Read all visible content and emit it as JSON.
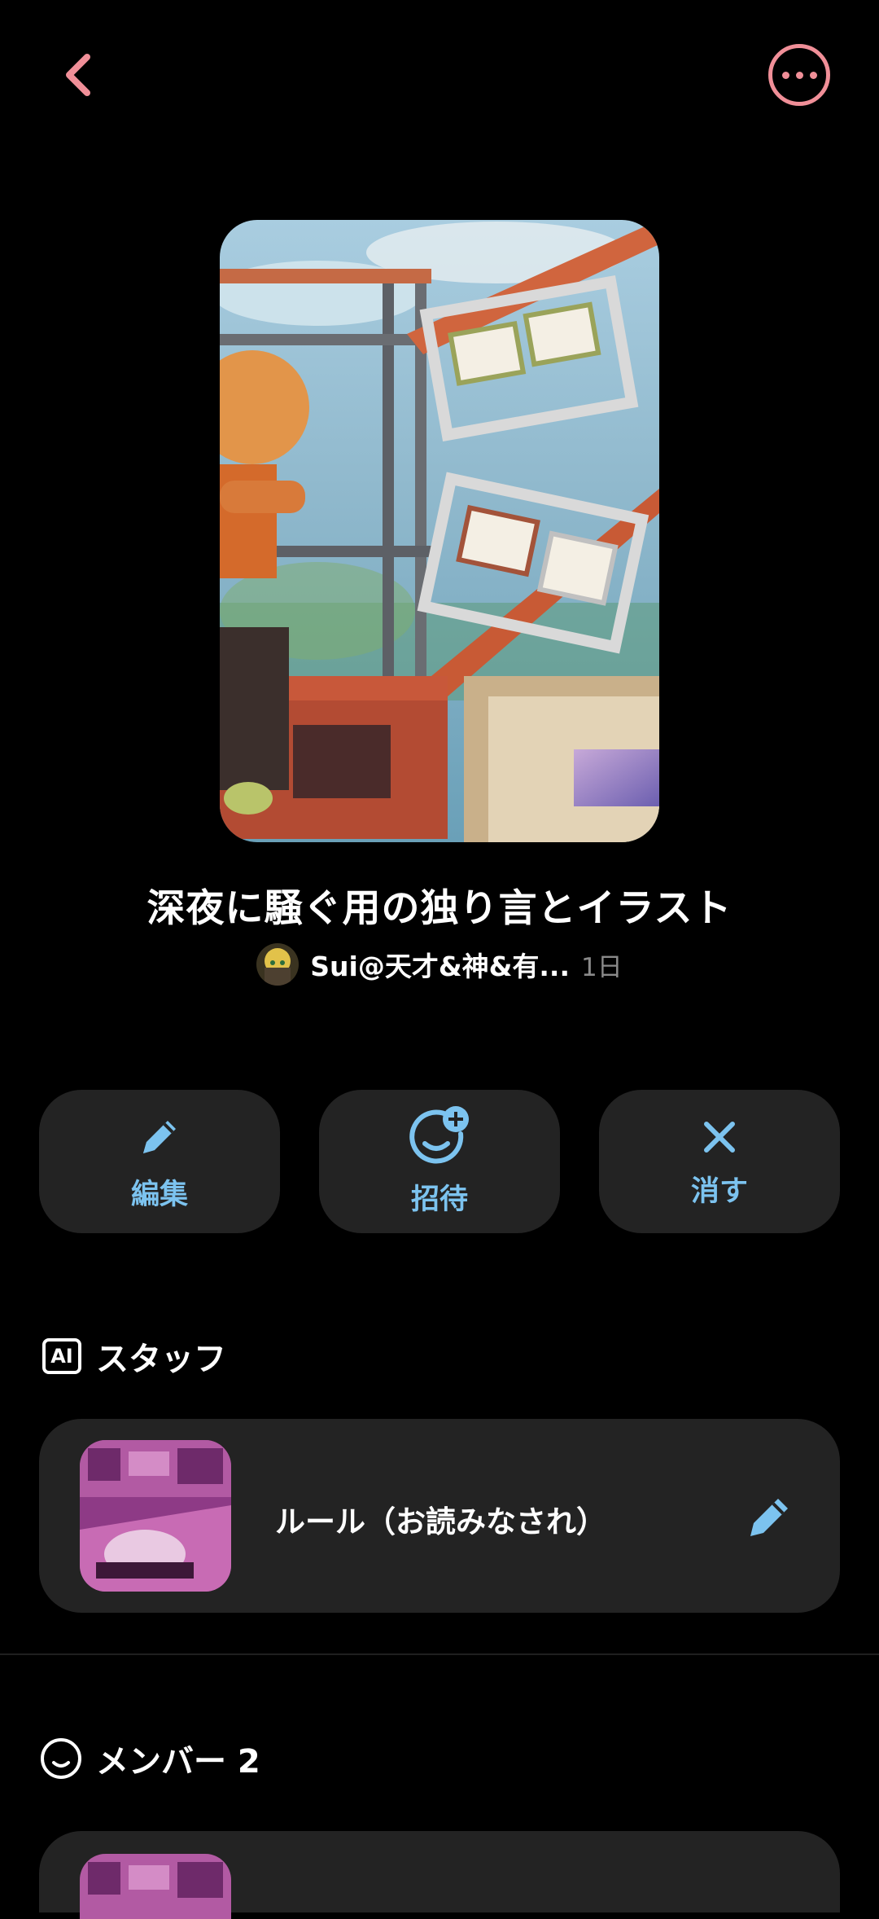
{
  "header": {
    "back_icon": "chevron-left-icon",
    "more_icon": "more-horizontal-icon",
    "accent_color": "#f08f98"
  },
  "chat": {
    "title": "深夜に騒ぐ用の独り言とイラスト",
    "host_name": "Sui@天才&神&有...",
    "time": "1日"
  },
  "actions": [
    {
      "label": "編集",
      "icon": "pencil-icon"
    },
    {
      "label": "招待",
      "icon": "invite-icon"
    },
    {
      "label": "消す",
      "icon": "close-icon"
    }
  ],
  "action_color": "#7cc3ef",
  "staff": {
    "badge": "AI",
    "heading": "スタッフ",
    "items": [
      {
        "label": "ルール（お読みなされ）",
        "icon": "pencil-icon"
      }
    ]
  },
  "members": {
    "heading": "メンバー 2"
  }
}
